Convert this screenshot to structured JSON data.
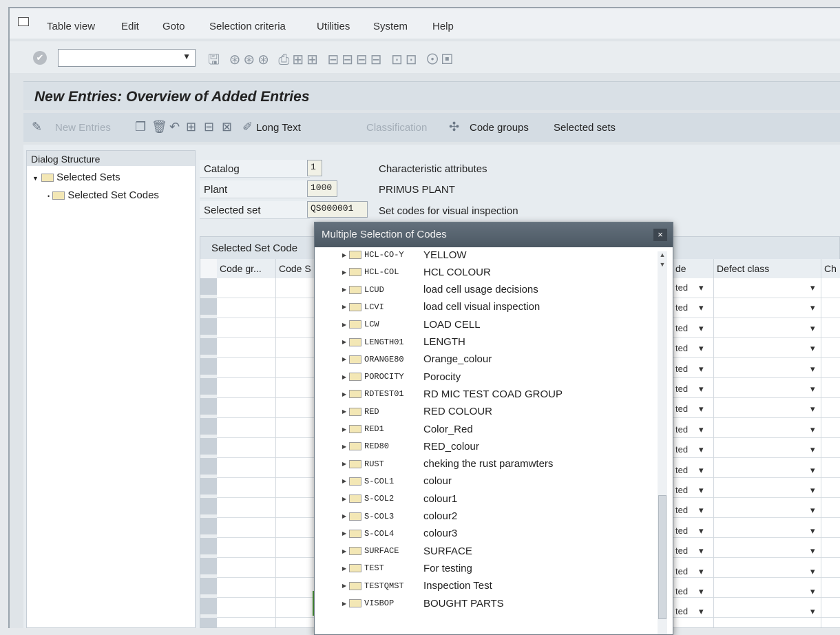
{
  "menu": [
    "Table view",
    "Edit",
    "Goto",
    "Selection criteria",
    "Utilities",
    "System",
    "Help"
  ],
  "page_title": "New Entries: Overview of Added Entries",
  "app_toolbar": {
    "new_entries": "New Entries",
    "long_text": "Long Text",
    "classification": "Classification",
    "code_groups": "Code groups",
    "selected_sets": "Selected sets"
  },
  "dialog_structure": {
    "title": "Dialog Structure",
    "items": [
      "Selected Sets",
      "Selected Set Codes"
    ]
  },
  "header_fields": [
    {
      "label": "Catalog",
      "value": "1",
      "desc": "Characteristic attributes"
    },
    {
      "label": "Plant",
      "value": "1000",
      "desc": "PRIMUS PLANT"
    },
    {
      "label": "Selected set",
      "value": "QS000001",
      "desc": "Set codes for visual inspection"
    }
  ],
  "table": {
    "title": "Selected Set Code",
    "columns": [
      "Code gr...",
      "Code S",
      "de",
      "Defect class",
      "Ch"
    ],
    "row_value": "ted"
  },
  "popup": {
    "title": "Multiple Selection of Codes",
    "close": "×",
    "rows": [
      {
        "code": "HCL-CO-Y",
        "desc": "YELLOW"
      },
      {
        "code": "HCL-COL",
        "desc": "HCL COLOUR"
      },
      {
        "code": "LCUD",
        "desc": "load cell usage decisions"
      },
      {
        "code": "LCVI",
        "desc": "load cell visual inspection"
      },
      {
        "code": "LCW",
        "desc": "LOAD CELL"
      },
      {
        "code": "LENGTH01",
        "desc": "LENGTH"
      },
      {
        "code": "ORANGE80",
        "desc": "Orange_colour"
      },
      {
        "code": "POROCITY",
        "desc": "Porocity"
      },
      {
        "code": "RDTEST01",
        "desc": "RD MIC TEST COAD GROUP"
      },
      {
        "code": "RED",
        "desc": "RED COLOUR"
      },
      {
        "code": "RED1",
        "desc": "Color_Red"
      },
      {
        "code": "RED80",
        "desc": "RED_colour"
      },
      {
        "code": "RUST",
        "desc": "cheking the rust paramwters"
      },
      {
        "code": "S-COL1",
        "desc": "colour"
      },
      {
        "code": "S-COL2",
        "desc": "colour1"
      },
      {
        "code": "S-COL3",
        "desc": "colour2"
      },
      {
        "code": "S-COL4",
        "desc": "colour3"
      },
      {
        "code": "SURFACE",
        "desc": "SURFACE"
      },
      {
        "code": "TEST",
        "desc": "For testing"
      },
      {
        "code": "TESTQMST",
        "desc": "Inspection Test"
      },
      {
        "code": "VISBOP",
        "desc": "BOUGHT PARTS"
      }
    ]
  },
  "colors": {
    "highlight": "#4f9d3a",
    "popup_title": "#55616c",
    "title_bar": "#d9e0e6"
  },
  "icons": [
    "check-icon",
    "save-icon",
    "delete-icon",
    "folder-icon",
    "close-icon"
  ]
}
